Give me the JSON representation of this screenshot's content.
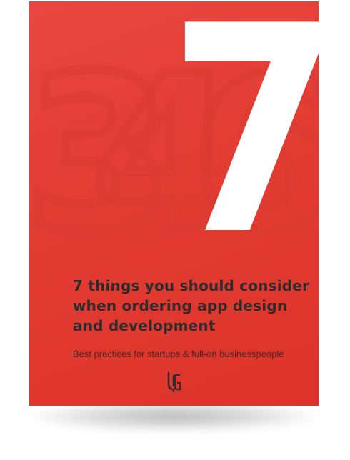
{
  "cover": {
    "big_number": "7",
    "background_digits": [
      "3",
      "4",
      "6"
    ],
    "title_lines": [
      "7 things you should consider",
      "when ordering app design",
      "and development"
    ],
    "subtitle": "Best practices for startups & full-on businesspeople",
    "logo_icon": "ug-monogram-icon"
  },
  "colors": {
    "cover_red": "#e23b31",
    "number_white": "#ffffff",
    "title_text": "#2c2c2c"
  }
}
